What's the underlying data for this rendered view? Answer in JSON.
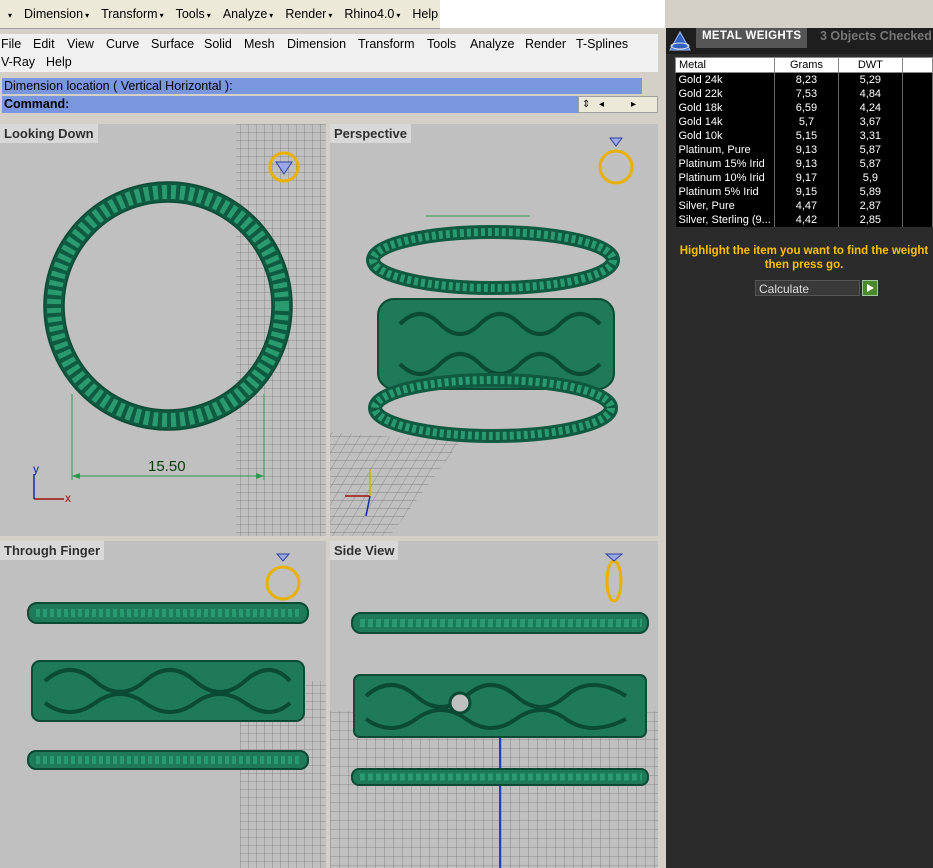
{
  "toolbar": {
    "items": [
      "Dimension",
      "Transform",
      "Tools",
      "Analyze",
      "Render",
      "Rhino4.0",
      "Help"
    ]
  },
  "menu": {
    "row1": [
      "File",
      "Edit",
      "View",
      "Curve",
      "Surface",
      "Solid",
      "Mesh",
      "Dimension",
      "Transform",
      "Tools",
      "Analyze",
      "Render",
      "T-Splines"
    ],
    "row2": [
      "V-Ray",
      "Help"
    ]
  },
  "command": {
    "prompt": "Dimension location ( Vertical  Horizontal ):",
    "label": "Command:"
  },
  "viewports": {
    "top_left": "Looking Down",
    "top_right": "Perspective",
    "bottom_left": "Through Finger",
    "bottom_right": "Side View",
    "dimension_value": "15.50",
    "axis_x": "x",
    "axis_y": "y"
  },
  "panel": {
    "title": "METAL WEIGHTS",
    "status": "3 Objects Checked",
    "columns": [
      "Metal",
      "Grams",
      "DWT"
    ],
    "rows": [
      [
        "Gold 24k",
        "8,23",
        "5,29"
      ],
      [
        "Gold 22k",
        "7,53",
        "4,84"
      ],
      [
        "Gold 18k",
        "6,59",
        "4,24"
      ],
      [
        "Gold 14k",
        "5,7",
        "3,67"
      ],
      [
        "Gold 10k",
        "5,15",
        "3,31"
      ],
      [
        "Platinum, Pure",
        "9,13",
        "5,87"
      ],
      [
        "Platinum 15% Irid",
        "9,13",
        "5,87"
      ],
      [
        "Platinum 10% Irid",
        "9,17",
        "5,9"
      ],
      [
        "Platinum 5% Irid",
        "9,15",
        "5,89"
      ],
      [
        "Silver, Pure",
        "4,47",
        "2,87"
      ],
      [
        "Silver, Sterling (9...",
        "4,42",
        "2,85"
      ]
    ],
    "hint_line1": "Highlight the item you want to find the weight",
    "hint_line2": "then press go.",
    "calc_value": "Calculate"
  },
  "colors": {
    "ring_green": "#1f7a5a",
    "command_bar": "#7a96df",
    "hint_yellow": "#ffc000"
  }
}
